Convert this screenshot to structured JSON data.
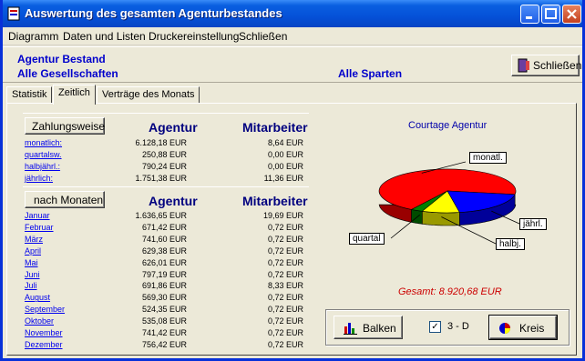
{
  "window": {
    "title": "Auswertung des gesamten Agenturbestandes"
  },
  "menu": [
    "Diagramm",
    "Daten und Listen",
    "Druckereinstellung",
    "Schließen"
  ],
  "header": {
    "line1": "Agentur Bestand",
    "line2": "Alle Gesellschaften",
    "sparten": "Alle Sparten",
    "close_button": "Schließen"
  },
  "tabs": [
    "Statistik",
    "Zeitlich",
    "Verträge des Monats"
  ],
  "active_tab": "Zeitlich",
  "payment": {
    "button": "Zahlungsweise",
    "col_agentur": "Agentur",
    "col_mitarbeiter": "Mitarbeiter",
    "rows": [
      {
        "label": "monatlich:",
        "agentur": "6.128,18 EUR",
        "mitarbeiter": "8,64 EUR"
      },
      {
        "label": "quartalsw.",
        "agentur": "250,88 EUR",
        "mitarbeiter": "0,00 EUR"
      },
      {
        "label": "halbjährl.:",
        "agentur": "790,24 EUR",
        "mitarbeiter": "0,00 EUR"
      },
      {
        "label": "jährlich:",
        "agentur": "1.751,38 EUR",
        "mitarbeiter": "11,36 EUR"
      }
    ]
  },
  "months": {
    "button": "nach Monaten",
    "col_agentur": "Agentur",
    "col_mitarbeiter": "Mitarbeiter",
    "rows": [
      {
        "label": "Januar",
        "agentur": "1.636,65 EUR",
        "mitarbeiter": "19,69 EUR"
      },
      {
        "label": "Februar",
        "agentur": "671,42 EUR",
        "mitarbeiter": "0,72 EUR"
      },
      {
        "label": "März",
        "agentur": "741,60 EUR",
        "mitarbeiter": "0,72 EUR"
      },
      {
        "label": "April",
        "agentur": "629,38 EUR",
        "mitarbeiter": "0,72 EUR"
      },
      {
        "label": "Mai",
        "agentur": "626,01 EUR",
        "mitarbeiter": "0,72 EUR"
      },
      {
        "label": "Juni",
        "agentur": "797,19 EUR",
        "mitarbeiter": "0,72 EUR"
      },
      {
        "label": "Juli",
        "agentur": "691,86 EUR",
        "mitarbeiter": "8,33 EUR"
      },
      {
        "label": "August",
        "agentur": "569,30 EUR",
        "mitarbeiter": "0,72 EUR"
      },
      {
        "label": "September",
        "agentur": "524,35 EUR",
        "mitarbeiter": "0,72 EUR"
      },
      {
        "label": "Oktober",
        "agentur": "535,08 EUR",
        "mitarbeiter": "0,72 EUR"
      },
      {
        "label": "November",
        "agentur": "741,42 EUR",
        "mitarbeiter": "0,72 EUR"
      },
      {
        "label": "Dezember",
        "agentur": "756,42 EUR",
        "mitarbeiter": "0,72 EUR"
      }
    ]
  },
  "chart_data": {
    "type": "pie",
    "title": "Courtage Agentur",
    "categories": [
      "monatl.",
      "quartal",
      "halbj.",
      "jährl."
    ],
    "values": [
      6128.18,
      250.88,
      790.24,
      1751.38
    ],
    "colors": [
      "#ff0000",
      "#008000",
      "#ffff00",
      "#0000ff"
    ],
    "three_d": true
  },
  "total": "Gesamt: 8.920,68 EUR",
  "controls": {
    "balken": "Balken",
    "three_d_label": "3 - D",
    "three_d_checked": true,
    "kreis": "Kreis"
  }
}
